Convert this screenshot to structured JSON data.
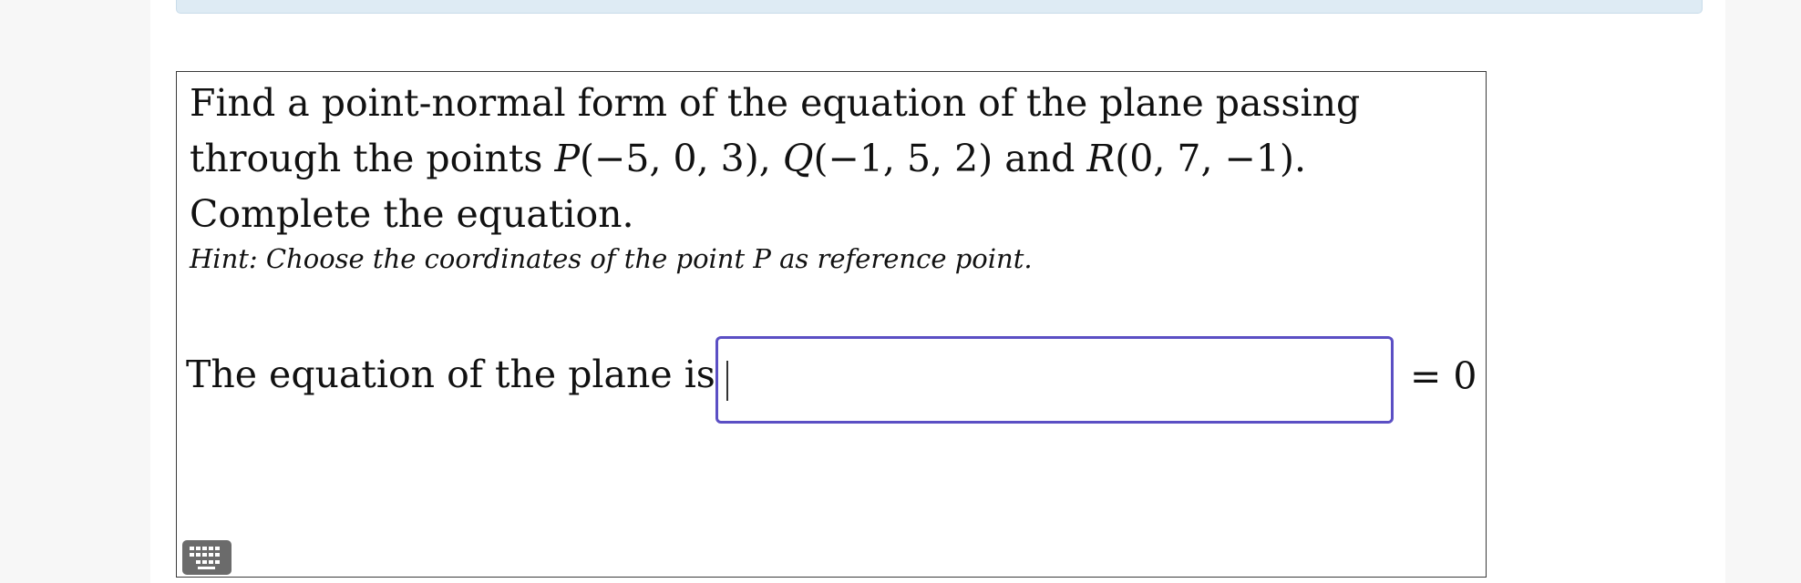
{
  "question": {
    "line_intro": "Find a point-normal form of the equation of the plane passing through the points ",
    "p_name": "P",
    "p_coords": "(−5, 0, 3)",
    "q_name": "Q",
    "q_coords": "(−1, 5, 2)",
    "and_text": " and ",
    "r_name": "R",
    "r_coords": "(0, 7, −1)",
    "line_end": ". Complete the equation.",
    "sep": ", ",
    "hint": "Hint: Choose the coordinates of the point P as reference point."
  },
  "answer": {
    "label": "The equation of the plane is:",
    "value": "",
    "rhs": "= 0"
  },
  "icons": {
    "keyboard": "keyboard-icon"
  },
  "colors": {
    "input_border": "#5b4fc4",
    "banner": "#deebf4"
  }
}
